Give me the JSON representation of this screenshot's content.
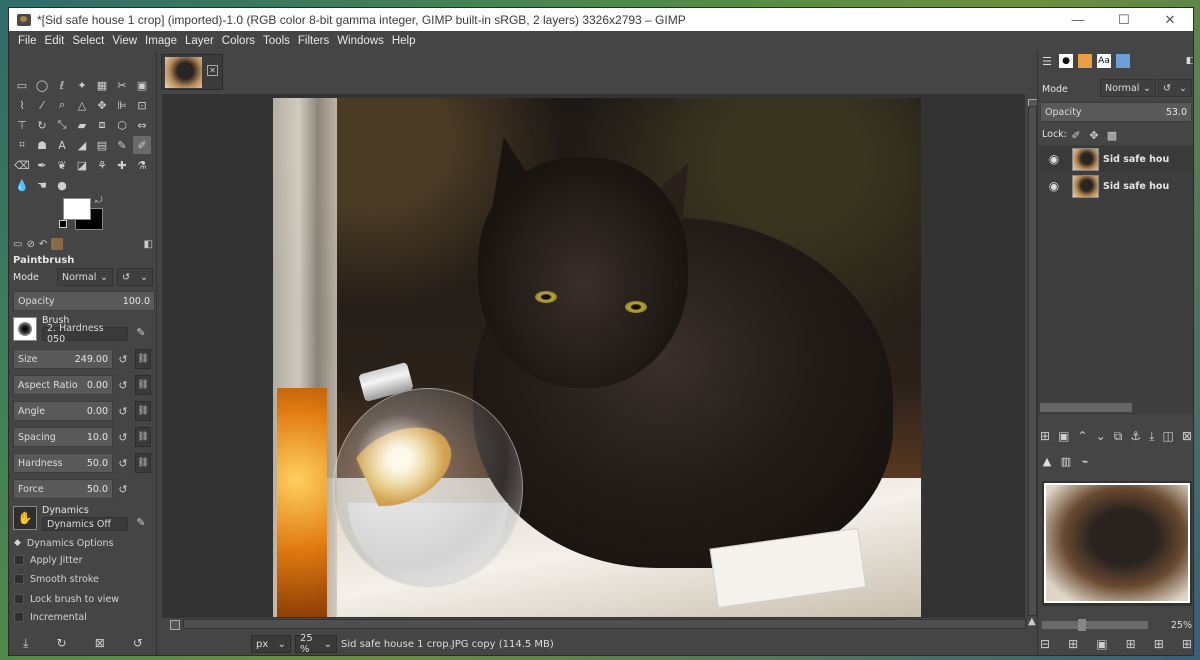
{
  "window": {
    "title": "*[Sid safe house 1 crop] (imported)-1.0 (RGB color 8-bit gamma integer, GIMP built-in sRGB, 2 layers) 3326x2793 – GIMP",
    "minimize": "—",
    "maximize": "☐",
    "close": "✕"
  },
  "menu": [
    "File",
    "Edit",
    "Select",
    "View",
    "Image",
    "Layer",
    "Colors",
    "Tools",
    "Filters",
    "Windows",
    "Help"
  ],
  "tool_options": {
    "title": "Paintbrush",
    "mode_label": "Mode",
    "mode_value": "Normal",
    "opacity_label": "Opacity",
    "opacity_value": "100.0",
    "brush_label": "Brush",
    "brush_value": "2. Hardness 050",
    "size_label": "Size",
    "size_value": "249.00",
    "aspect_label": "Aspect Ratio",
    "aspect_value": "0.00",
    "angle_label": "Angle",
    "angle_value": "0.00",
    "spacing_label": "Spacing",
    "spacing_value": "10.0",
    "hardness_label": "Hardness",
    "hardness_value": "50.0",
    "force_label": "Force",
    "force_value": "50.0",
    "dynamics_label": "Dynamics",
    "dynamics_value": "Dynamics Off",
    "dynamics_options": "Dynamics Options",
    "apply_jitter": "Apply Jitter",
    "smooth_stroke": "Smooth stroke",
    "lock_brush": "Lock brush to view",
    "incremental": "Incremental"
  },
  "status": {
    "unit": "px",
    "zoom": "25 %",
    "message": "Sid safe house 1 crop.JPG copy (114.5 MB)"
  },
  "layers_panel": {
    "mode_label": "Mode",
    "mode_value": "Normal",
    "opacity_label": "Opacity",
    "opacity_value": "53.0",
    "lock_label": "Lock:",
    "layers": [
      {
        "name": "Sid safe hou"
      },
      {
        "name": "Sid safe hou"
      }
    ]
  },
  "navigator": {
    "zoom": "25%"
  },
  "colors": {
    "foreground": "#ffffff",
    "background": "#000000"
  }
}
